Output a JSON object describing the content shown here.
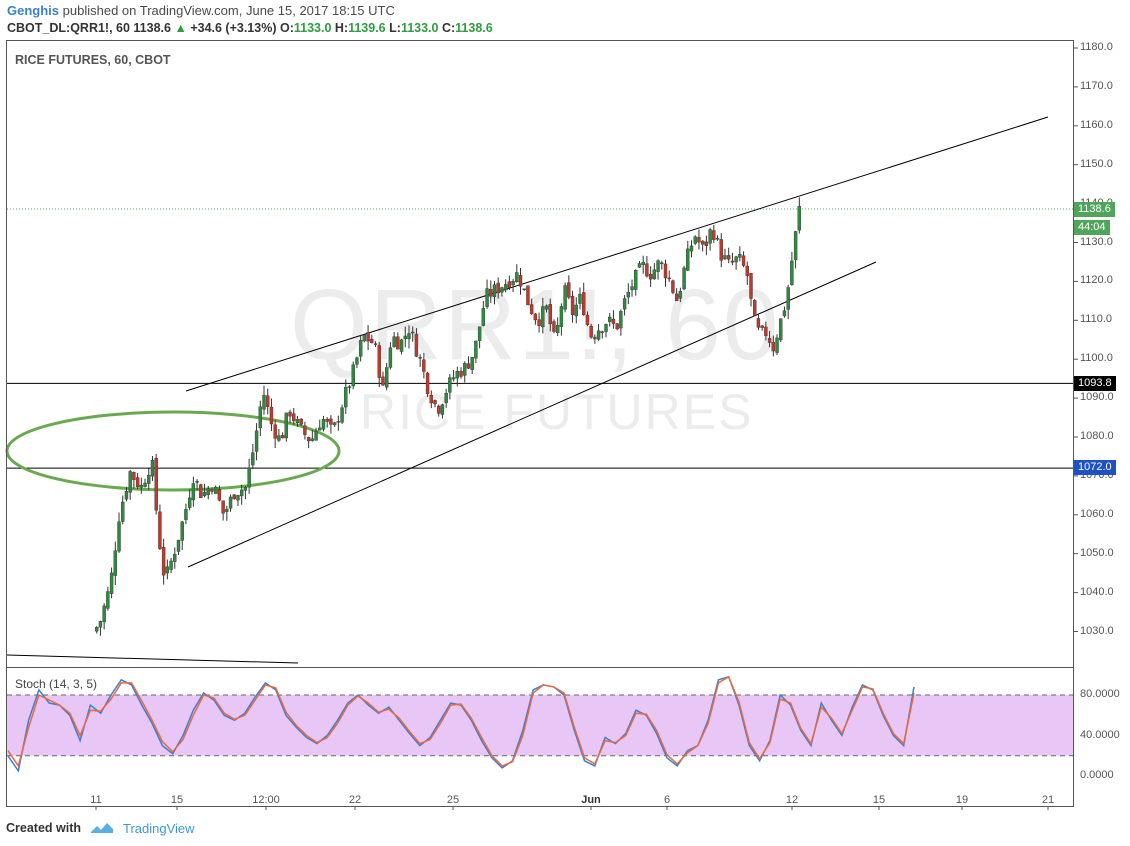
{
  "header": {
    "author": "Genghis",
    "published_text": "published on TradingView.com, June 15, 2017 18:15 UTC"
  },
  "ticker": {
    "symbol": "CBOT_DL:QRR1!, 60",
    "last": "1138.6",
    "change": "+34.6 (+3.13%)",
    "open_label": "O:",
    "open": "1133.0",
    "high_label": "H:",
    "high": "1139.6",
    "low_label": "L:",
    "low": "1133.0",
    "close_label": "C:",
    "close": "1138.6"
  },
  "chart_title": "RICE FUTURES, 60, CBOT",
  "watermark": {
    "line1": "QRR1!, 60",
    "line2": "RICE FUTURES"
  },
  "price_tag": "1138.6",
  "time_tag": "44:04",
  "level_tags": [
    "1093.8",
    "1072.0"
  ],
  "stoch_title": "Stoch (14, 3, 5)",
  "footer": {
    "created_with": "Created with",
    "brand": "TradingView"
  },
  "colors": {
    "up": "#2e8b3e",
    "down": "#c0392b",
    "ellipse": "#6aaa4e",
    "stoch_fill": "#e8c6f5",
    "stoch_k": "#3a7fd6",
    "stoch_d": "#e86a3c"
  },
  "chart_data": [
    {
      "type": "candlestick",
      "title": "RICE FUTURES, 60, CBOT",
      "ylim": [
        1025,
        1182
      ],
      "y_ticks": [
        1030,
        1040,
        1050,
        1060,
        1070,
        1080,
        1090,
        1100,
        1110,
        1120,
        1130,
        1140,
        1150,
        1160,
        1170,
        1180
      ],
      "x_ticks": [
        "11",
        "15",
        "12:00",
        "22",
        "25",
        "Jun",
        "6",
        "12",
        "15",
        "19",
        "21"
      ],
      "horizontal_levels": [
        1093.8,
        1072.0
      ],
      "last_price": 1138.6,
      "close_path": [
        [
          11,
          1030
        ],
        [
          11.3,
          1032
        ],
        [
          11.8,
          1042
        ],
        [
          12.2,
          1060
        ],
        [
          12.7,
          1071
        ],
        [
          13.2,
          1067
        ],
        [
          13.7,
          1074
        ],
        [
          14.0,
          1055
        ],
        [
          14.3,
          1043
        ],
        [
          14.7,
          1050
        ],
        [
          15.2,
          1060
        ],
        [
          15.6,
          1070
        ],
        [
          16.0,
          1065
        ],
        [
          16.5,
          1068
        ],
        [
          17.0,
          1060
        ],
        [
          17.5,
          1066
        ],
        [
          18.0,
          1067
        ],
        [
          18.4,
          1078
        ],
        [
          18.8,
          1092
        ],
        [
          19.2,
          1083
        ],
        [
          19.6,
          1079
        ],
        [
          20.0,
          1087
        ],
        [
          20.5,
          1082
        ],
        [
          21.0,
          1079
        ],
        [
          21.5,
          1085
        ],
        [
          22.0,
          1081
        ],
        [
          22.4,
          1088
        ],
        [
          22.9,
          1096
        ],
        [
          23.4,
          1106
        ],
        [
          23.9,
          1104
        ],
        [
          24.3,
          1092
        ],
        [
          24.7,
          1106
        ],
        [
          25.1,
          1104
        ],
        [
          25.5,
          1108
        ],
        [
          26.0,
          1100
        ],
        [
          26.4,
          1092
        ],
        [
          26.8,
          1087
        ],
        [
          27.2,
          1092
        ],
        [
          27.6,
          1096
        ],
        [
          28.1,
          1098
        ],
        [
          28.5,
          1102
        ],
        [
          29.0,
          1116
        ],
        [
          29.5,
          1118
        ],
        [
          30.0,
          1120
        ],
        [
          30.5,
          1122
        ],
        [
          31.0,
          1114
        ],
        [
          31.4,
          1110
        ],
        [
          31.8,
          1113
        ],
        [
          32.2,
          1104
        ],
        [
          32.6,
          1118
        ],
        [
          33.0,
          1112
        ],
        [
          33.4,
          1116
        ],
        [
          33.8,
          1106
        ],
        [
          34.2,
          1108
        ],
        [
          34.6,
          1110
        ],
        [
          35.0,
          1108
        ],
        [
          35.4,
          1115
        ],
        [
          35.8,
          1120
        ],
        [
          36.2,
          1124
        ],
        [
          36.6,
          1122
        ],
        [
          37.0,
          1125
        ],
        [
          37.4,
          1121
        ],
        [
          37.8,
          1115
        ],
        [
          38.2,
          1125
        ],
        [
          38.6,
          1132
        ],
        [
          39.0,
          1128
        ],
        [
          39.4,
          1134
        ],
        [
          39.8,
          1127
        ],
        [
          40.2,
          1124
        ],
        [
          40.6,
          1126
        ],
        [
          41.0,
          1122
        ],
        [
          41.3,
          1110
        ],
        [
          41.6,
          1106
        ],
        [
          41.9,
          1107
        ],
        [
          42.2,
          1103
        ],
        [
          42.5,
          1109
        ],
        [
          42.8,
          1115
        ],
        [
          43.1,
          1127
        ],
        [
          43.4,
          1138.6
        ]
      ]
    },
    {
      "type": "line",
      "title": "Stoch (14, 3, 5)",
      "ylim": [
        -5,
        100
      ],
      "y_ticks": [
        0.0,
        40.0,
        80.0
      ],
      "band": [
        20,
        80
      ],
      "series": [
        {
          "values": [
            20,
            5,
            55,
            85,
            72,
            70,
            60,
            35,
            70,
            62,
            80,
            95,
            90,
            70,
            52,
            30,
            22,
            40,
            65,
            82,
            75,
            60,
            55,
            62,
            78,
            92,
            85,
            60,
            48,
            38,
            32,
            40,
            55,
            72,
            80,
            70,
            62,
            68,
            55,
            42,
            30,
            38,
            55,
            72,
            70,
            55,
            35,
            18,
            8,
            15,
            45,
            85,
            90,
            88,
            80,
            45,
            15,
            10,
            38,
            32,
            42,
            65,
            60,
            42,
            18,
            10,
            25,
            30,
            55,
            95,
            98,
            70,
            30,
            15,
            35,
            80,
            70,
            45,
            30,
            72,
            55,
            40,
            68,
            90,
            85,
            60,
            40,
            30,
            88
          ]
        },
        {
          "values": [
            25,
            10,
            48,
            80,
            75,
            70,
            62,
            40,
            65,
            64,
            76,
            92,
            92,
            74,
            55,
            34,
            24,
            36,
            60,
            80,
            77,
            62,
            56,
            60,
            75,
            90,
            87,
            63,
            50,
            40,
            33,
            38,
            52,
            70,
            79,
            72,
            63,
            66,
            57,
            44,
            32,
            36,
            52,
            70,
            71,
            57,
            38,
            20,
            10,
            14,
            40,
            82,
            90,
            88,
            82,
            48,
            18,
            12,
            35,
            33,
            40,
            62,
            61,
            45,
            21,
            12,
            23,
            30,
            52,
            92,
            98,
            73,
            33,
            17,
            33,
            76,
            72,
            47,
            32,
            68,
            57,
            42,
            65,
            88,
            86,
            62,
            42,
            32,
            82
          ]
        }
      ]
    }
  ]
}
